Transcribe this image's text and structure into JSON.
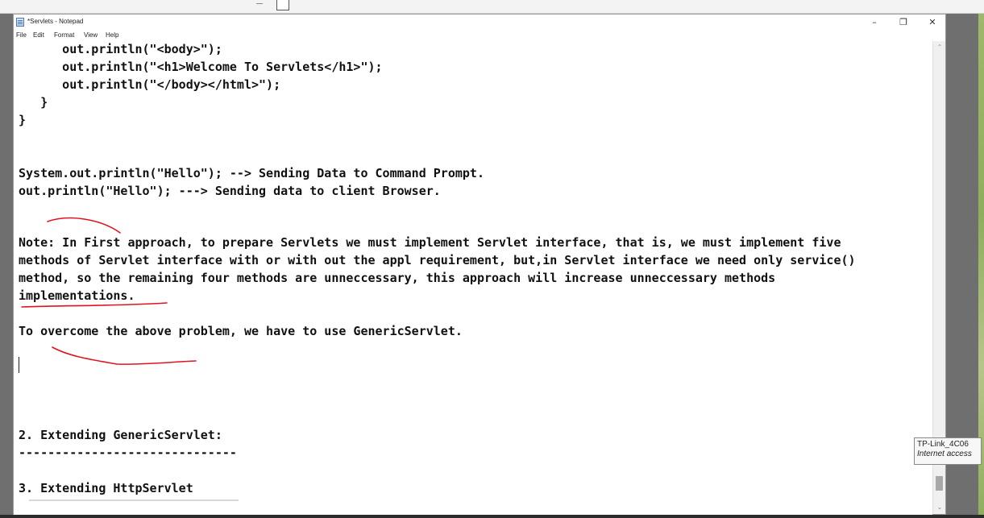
{
  "window": {
    "title": "*Servlets - Notepad",
    "controls": {
      "minimize": "–",
      "maximize": "❐",
      "close": "✕"
    }
  },
  "menu": [
    "File",
    "Edit",
    "Format",
    "View",
    "Help"
  ],
  "editor": {
    "lines": [
      "      out.println(\"<body>\");",
      "      out.println(\"<h1>Welcome To Servlets</h1>\");",
      "      out.println(\"</body></html>\");",
      "   }",
      "}",
      "",
      "",
      "System.out.println(\"Hello\"); --> Sending Data to Command Prompt.",
      "out.println(\"Hello\"); ---> Sending data to client Browser.",
      "",
      "",
      "Note: In First approach, to prepare Servlets we must implement Servlet interface, that is, we must implement five",
      "methods of Servlet interface with or with out the appl requirement, but,in Servlet interface we need only service()",
      "method, so the remaining four methods are unneccessary, this approach will increase unneccessary methods",
      "implementations.",
      "",
      "To overcome the above problem, we have to use GenericServlet.",
      "",
      "",
      "",
      "",
      "",
      "2. Extending GenericServlet:",
      "------------------------------",
      "",
      "3. Extending HttpServlet"
    ]
  },
  "network_tooltip": {
    "name": "TP-Link_4C06",
    "status": "Internet access"
  },
  "colors": {
    "annotation_ink": "#e0141e",
    "window_bg": "#ffffff",
    "desktop_bg": "#6f6f6f"
  }
}
